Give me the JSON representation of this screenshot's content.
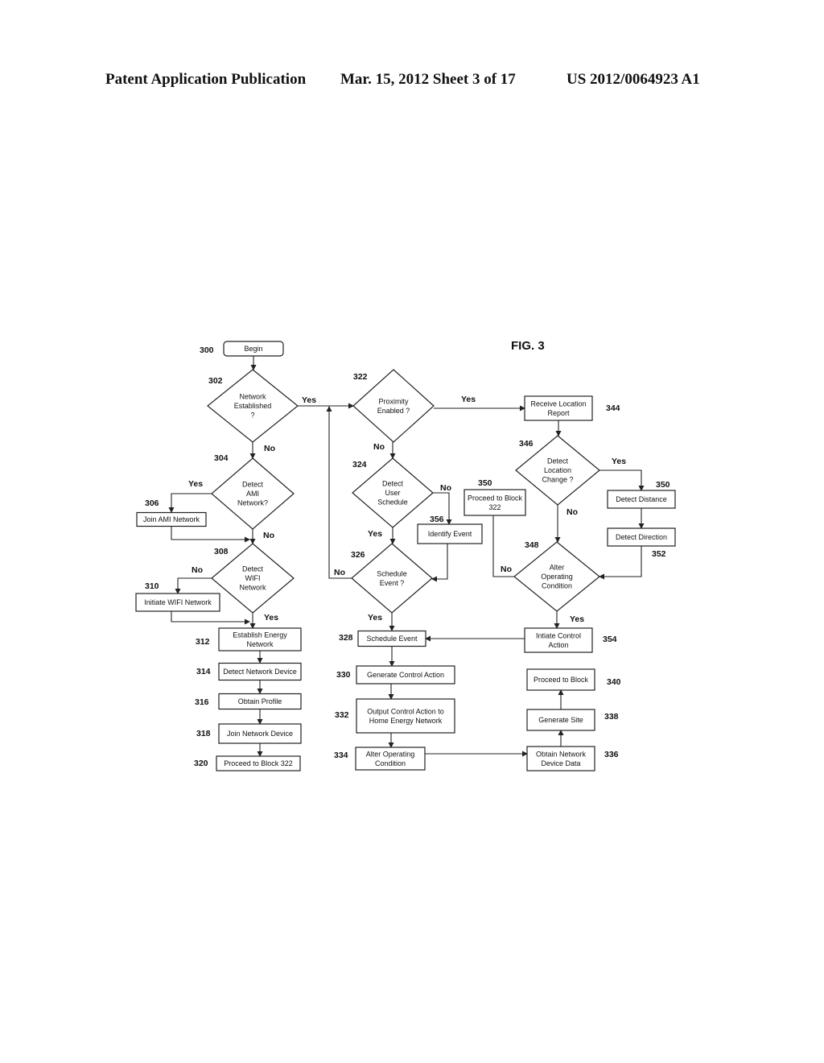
{
  "header": {
    "left": "Patent Application Publication",
    "middle": "Mar. 15, 2012  Sheet 3 of 17",
    "right": "US 2012/0064923 A1"
  },
  "figure_label": "FIG. 3",
  "nodes": [
    {
      "id": "300",
      "type": "terminal",
      "lines": [
        "Begin"
      ]
    },
    {
      "id": "302",
      "type": "decision",
      "lines": [
        "Network",
        "Established",
        "?"
      ]
    },
    {
      "id": "304",
      "type": "decision",
      "lines": [
        "Detect",
        "AMI",
        "Network?"
      ]
    },
    {
      "id": "306",
      "type": "process",
      "lines": [
        "Join  AMI Network"
      ]
    },
    {
      "id": "308",
      "type": "decision",
      "lines": [
        "Detect",
        "WIFI",
        "Network"
      ]
    },
    {
      "id": "310",
      "type": "process",
      "lines": [
        "Initiate WIFI Network"
      ]
    },
    {
      "id": "312",
      "type": "process",
      "lines": [
        "Establish Energy",
        "Network"
      ]
    },
    {
      "id": "314",
      "type": "process",
      "lines": [
        "Detect Network Device"
      ]
    },
    {
      "id": "316",
      "type": "process",
      "lines": [
        "Obtain Profile"
      ]
    },
    {
      "id": "318",
      "type": "process",
      "lines": [
        "Join Network Device"
      ]
    },
    {
      "id": "320",
      "type": "process",
      "lines": [
        "Proceed to Block 322"
      ]
    },
    {
      "id": "322",
      "type": "decision",
      "lines": [
        "Proximity",
        "Enabled ?"
      ]
    },
    {
      "id": "324",
      "type": "decision",
      "lines": [
        "Detect",
        "User",
        "Schedule"
      ]
    },
    {
      "id": "356",
      "type": "process",
      "lines": [
        "Identify Event"
      ]
    },
    {
      "id": "326",
      "type": "decision",
      "lines": [
        "Schedule",
        "Event ?"
      ]
    },
    {
      "id": "328",
      "type": "process",
      "lines": [
        "Schedule Event"
      ]
    },
    {
      "id": "330",
      "type": "process",
      "lines": [
        "Generate Control Action"
      ]
    },
    {
      "id": "332",
      "type": "process",
      "lines": [
        "Output Control Action to",
        "Home Energy Network"
      ]
    },
    {
      "id": "334",
      "type": "process",
      "lines": [
        "Alter Operating",
        "Condition"
      ]
    },
    {
      "id": "344",
      "type": "process",
      "lines": [
        "Receive Location",
        "Report"
      ]
    },
    {
      "id": "346",
      "type": "decision",
      "lines": [
        "Detect",
        "Location",
        "Change ?"
      ]
    },
    {
      "id": "350a",
      "ref": "350",
      "type": "process",
      "lines": [
        "Proceed to Block",
        "322"
      ]
    },
    {
      "id": "350b",
      "ref": "350",
      "type": "process",
      "lines": [
        "Detect Distance"
      ]
    },
    {
      "id": "352",
      "type": "process",
      "lines": [
        "Detect Direction"
      ]
    },
    {
      "id": "348",
      "type": "decision",
      "lines": [
        "Alter",
        "Operating",
        "Condition"
      ]
    },
    {
      "id": "354",
      "type": "process",
      "lines": [
        "Intiate Control",
        "Action"
      ]
    },
    {
      "id": "336",
      "type": "process",
      "lines": [
        "Obtain Network",
        "Device Data"
      ]
    },
    {
      "id": "338",
      "type": "process",
      "lines": [
        "Generate Site"
      ]
    },
    {
      "id": "340",
      "type": "process",
      "lines": [
        "Proceed to Block"
      ]
    }
  ],
  "edges": [
    {
      "from": "300",
      "to": "302",
      "label": ""
    },
    {
      "from": "302",
      "to": "322",
      "label": "Yes"
    },
    {
      "from": "302",
      "to": "304",
      "label": "No"
    },
    {
      "from": "304",
      "to": "306",
      "label": "Yes"
    },
    {
      "from": "304",
      "to": "308",
      "label": "No"
    },
    {
      "from": "306",
      "to": "308",
      "label": ""
    },
    {
      "from": "308",
      "to": "310",
      "label": "No"
    },
    {
      "from": "308",
      "to": "312",
      "label": "Yes"
    },
    {
      "from": "310",
      "to": "312",
      "label": ""
    },
    {
      "from": "312",
      "to": "314",
      "label": ""
    },
    {
      "from": "314",
      "to": "316",
      "label": ""
    },
    {
      "from": "316",
      "to": "318",
      "label": ""
    },
    {
      "from": "318",
      "to": "320",
      "label": ""
    },
    {
      "from": "322",
      "to": "344",
      "label": "Yes"
    },
    {
      "from": "322",
      "to": "324",
      "label": "No"
    },
    {
      "from": "324",
      "to": "356",
      "label": "No"
    },
    {
      "from": "324",
      "to": "326",
      "label": "Yes"
    },
    {
      "from": "356",
      "to": "326",
      "label": ""
    },
    {
      "from": "326",
      "to": "322",
      "label": "No"
    },
    {
      "from": "326",
      "to": "328",
      "label": "Yes"
    },
    {
      "from": "328",
      "to": "330",
      "label": ""
    },
    {
      "from": "330",
      "to": "332",
      "label": ""
    },
    {
      "from": "332",
      "to": "334",
      "label": ""
    },
    {
      "from": "334",
      "to": "336",
      "label": ""
    },
    {
      "from": "336",
      "to": "338",
      "label": ""
    },
    {
      "from": "338",
      "to": "340",
      "label": ""
    },
    {
      "from": "344",
      "to": "346",
      "label": ""
    },
    {
      "from": "346",
      "to": "350b",
      "label": "Yes"
    },
    {
      "from": "346",
      "to": "348",
      "label": "No"
    },
    {
      "from": "350b",
      "to": "352",
      "label": ""
    },
    {
      "from": "352",
      "to": "348",
      "label": ""
    },
    {
      "from": "348",
      "to": "350a",
      "label": "No"
    },
    {
      "from": "348",
      "to": "354",
      "label": "Yes"
    },
    {
      "from": "354",
      "to": "328",
      "label": ""
    }
  ]
}
